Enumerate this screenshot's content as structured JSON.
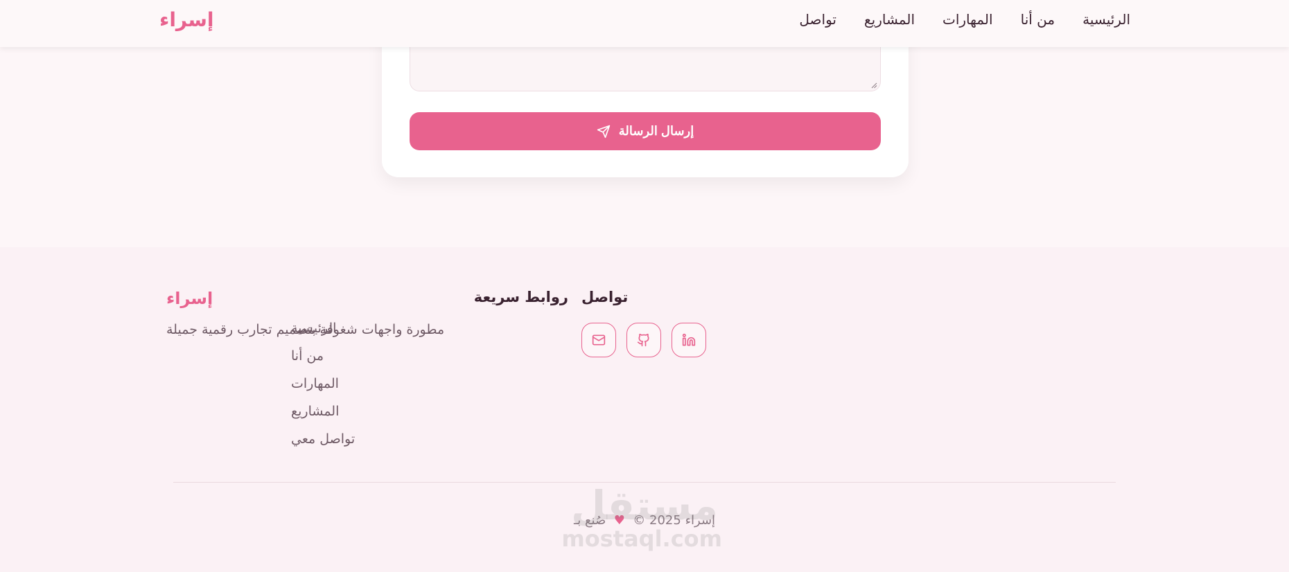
{
  "header": {
    "brand": "إسراء",
    "nav": [
      "الرئيسية",
      "من أنا",
      "المهارات",
      "المشاريع",
      "تواصل"
    ]
  },
  "contact_form": {
    "send_label": "إرسال الرسالة"
  },
  "footer": {
    "brand": {
      "title": "إسراء",
      "tagline": "مطورة واجهات شغوفة بتصميم تجارب رقمية جميلة"
    },
    "quick_links": {
      "title": "روابط سريعة",
      "items": [
        "الرئيسية",
        "من أنا",
        "المهارات",
        "المشاريع",
        "تواصل معي"
      ]
    },
    "contact": {
      "title": "تواصل",
      "icons": [
        "mail-icon",
        "github-icon",
        "linkedin-icon"
      ]
    },
    "copyright": {
      "prefix": "صُنع بـ",
      "suffix": "إسراء 2025 ©"
    }
  },
  "watermark": {
    "arabic": "مستقل",
    "latin": "mostaql.com"
  },
  "colors": {
    "accent": "#e8628e",
    "background": "#fdf6f8",
    "footer_bg": "#fbf1f5"
  }
}
